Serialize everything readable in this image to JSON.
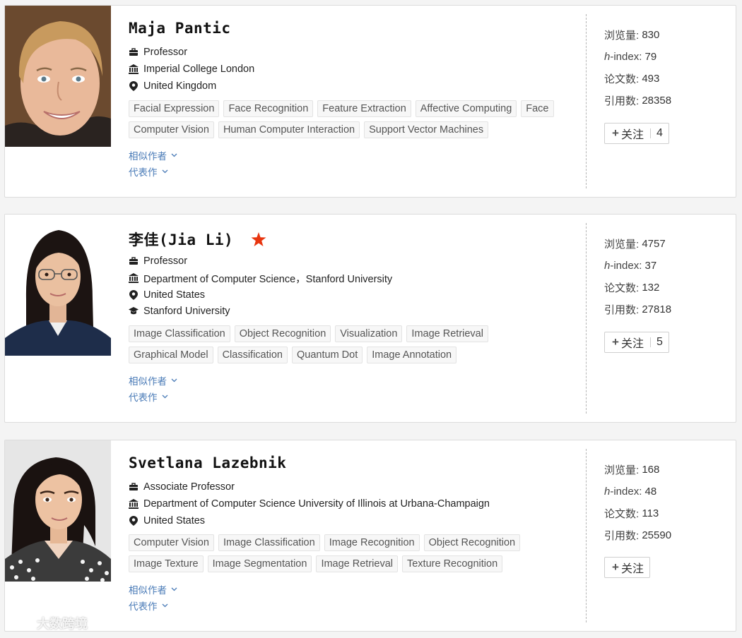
{
  "cards": [
    {
      "name": "Maja Pantic",
      "title": "Professor",
      "institution": "Imperial College London",
      "country": "United Kingdom",
      "tags_row1": [
        "Facial Expression",
        "Face Recognition",
        "Feature Extraction",
        "Affective Computing",
        "Face"
      ],
      "tags_row2": [
        "Computer Vision",
        "Human Computer Interaction",
        "Support Vector Machines"
      ],
      "similar_label": "相似作者",
      "works_label": "代表作",
      "stats": {
        "views_label": "浏览量:",
        "views": "830",
        "hindex_h": "h",
        "hindex_rest": "-index:",
        "hindex": "79",
        "papers_label": "论文数:",
        "papers": "493",
        "citations_label": "引用数:",
        "citations": "28358"
      },
      "follow_label": "关注",
      "follow_count": "4"
    },
    {
      "name": "李佳(Jia Li)",
      "title": "Professor",
      "institution": "Department of Computer Science，Stanford University",
      "country": "United States",
      "organization": "Stanford University",
      "tags_row1": [
        "Image Classification",
        "Object Recognition",
        "Visualization",
        "Image Retrieval"
      ],
      "tags_row2": [
        "Graphical Model",
        "Classification",
        "Quantum Dot",
        "Image Annotation"
      ],
      "similar_label": "相似作者",
      "works_label": "代表作",
      "stats": {
        "views_label": "浏览量:",
        "views": "4757",
        "hindex_h": "h",
        "hindex_rest": "-index:",
        "hindex": "37",
        "papers_label": "论文数:",
        "papers": "132",
        "citations_label": "引用数:",
        "citations": "27818"
      },
      "follow_label": "关注",
      "follow_count": "5"
    },
    {
      "name": "Svetlana Lazebnik",
      "title": "Associate Professor",
      "institution": "Department of Computer Science University of Illinois at Urbana-Champaign",
      "country": "United States",
      "tags_row1": [
        "Computer Vision",
        "Image Classification",
        "Image Recognition",
        "Object Recognition"
      ],
      "tags_row2": [
        "Image Texture",
        "Image Segmentation",
        "Image Retrieval",
        "Texture Recognition"
      ],
      "similar_label": "相似作者",
      "works_label": "代表作",
      "stats": {
        "views_label": "浏览量:",
        "views": "168",
        "hindex_h": "h",
        "hindex_rest": "-index:",
        "hindex": "48",
        "papers_label": "论文数:",
        "papers": "113",
        "citations_label": "引用数:",
        "citations": "25590"
      },
      "follow_label": "关注"
    }
  ],
  "colors": {
    "link": "#4a7bb7",
    "star": "#e8350f",
    "tag_bg": "#f7f7f7",
    "divider": "#b5b5b5"
  },
  "icons": {
    "title": "briefcase-icon",
    "institution": "institution-icon",
    "country": "location-pin-icon",
    "organization": "graduation-cap-icon",
    "star": "star-icon",
    "chevron": "chevron-down-icon",
    "follow": "plus-icon"
  },
  "watermark": "大数跨境"
}
